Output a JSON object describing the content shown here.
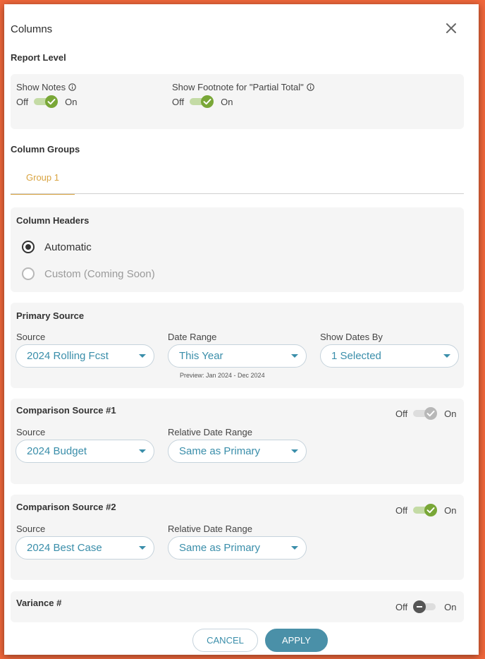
{
  "dialog": {
    "title": "Columns",
    "close_icon": "close-icon"
  },
  "report_level": {
    "heading": "Report Level",
    "show_notes": {
      "label": "Show Notes",
      "off": "Off",
      "on": "On",
      "state": "on"
    },
    "show_footnote": {
      "label": "Show Footnote for \"Partial Total\"",
      "off": "Off",
      "on": "On",
      "state": "on"
    }
  },
  "column_groups": {
    "heading": "Column Groups",
    "tabs": [
      {
        "label": "Group 1",
        "active": true
      }
    ]
  },
  "column_headers": {
    "heading": "Column Headers",
    "options": [
      {
        "label": "Automatic",
        "checked": true,
        "disabled": false
      },
      {
        "label": "Custom (Coming Soon)",
        "checked": false,
        "disabled": true
      }
    ]
  },
  "primary_source": {
    "heading": "Primary Source",
    "source": {
      "label": "Source",
      "value": "2024 Rolling Fcst"
    },
    "date_range": {
      "label": "Date Range",
      "value": "This Year",
      "preview": "Preview: Jan 2024 - Dec 2024"
    },
    "show_dates_by": {
      "label": "Show Dates By",
      "value": "1 Selected"
    }
  },
  "comparison_1": {
    "heading": "Comparison Source #1",
    "toggle": {
      "off": "Off",
      "on": "On",
      "state": "on-disabled"
    },
    "source": {
      "label": "Source",
      "value": "2024 Budget"
    },
    "relative_date_range": {
      "label": "Relative Date Range",
      "value": "Same as Primary"
    }
  },
  "comparison_2": {
    "heading": "Comparison Source #2",
    "toggle": {
      "off": "Off",
      "on": "On",
      "state": "on"
    },
    "source": {
      "label": "Source",
      "value": "2024 Best Case"
    },
    "relative_date_range": {
      "label": "Relative Date Range",
      "value": "Same as Primary"
    }
  },
  "variance": {
    "heading": "Variance #",
    "toggle": {
      "off": "Off",
      "on": "On",
      "state": "off"
    }
  },
  "footer": {
    "cancel_label": "CANCEL",
    "apply_label": "APPLY"
  },
  "colors": {
    "accent": "#3a8eaa",
    "tab_active": "#d9a441",
    "toggle_green": "#79a737",
    "frame": "#f0673b"
  }
}
